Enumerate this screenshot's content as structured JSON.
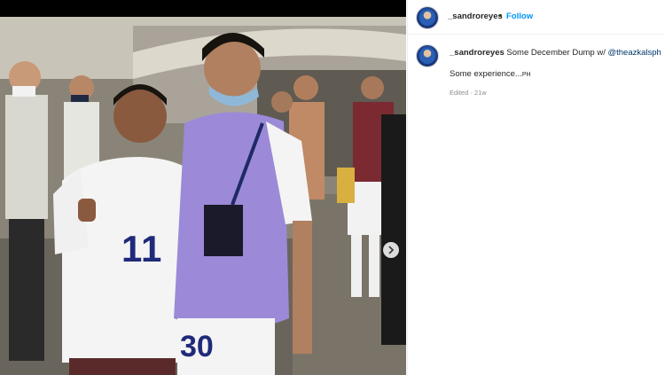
{
  "post": {
    "author": "_sandroreyes",
    "follow_label": "Follow",
    "separator": "•"
  },
  "caption": {
    "author": "_sandroreyes",
    "text": " Some December Dump w/ ",
    "mention": "@theazkalsph",
    "body": "Some experience...",
    "body_suffix": "PH"
  },
  "meta": {
    "edited": "Edited",
    "sep": " · ",
    "age": "21w"
  },
  "photo": {
    "jersey_number_left": "11",
    "jersey_number_right": "30"
  },
  "colors": {
    "accent": "#0095f6",
    "mention": "#00376b",
    "text": "#262626",
    "muted": "#8e8e8e"
  },
  "icons": {
    "carousel_next": "chevron-right-icon"
  }
}
